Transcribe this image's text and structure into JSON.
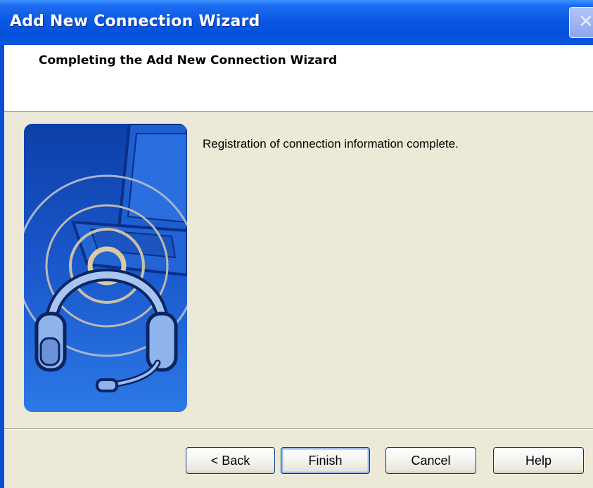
{
  "window": {
    "title": "Add New Connection Wizard",
    "close_icon": "close-icon"
  },
  "header": {
    "title": "Completing the Add New Connection Wizard"
  },
  "content": {
    "message": "Registration of connection information complete.",
    "illustration": "headset-laptop-illustration"
  },
  "buttons": {
    "back": "< Back",
    "finish": "Finish",
    "cancel": "Cancel",
    "help": "Help"
  },
  "colors": {
    "titlebar": "#0858e4",
    "dialog_bg": "#ece9d8",
    "art_bg": "#1a56c8"
  }
}
